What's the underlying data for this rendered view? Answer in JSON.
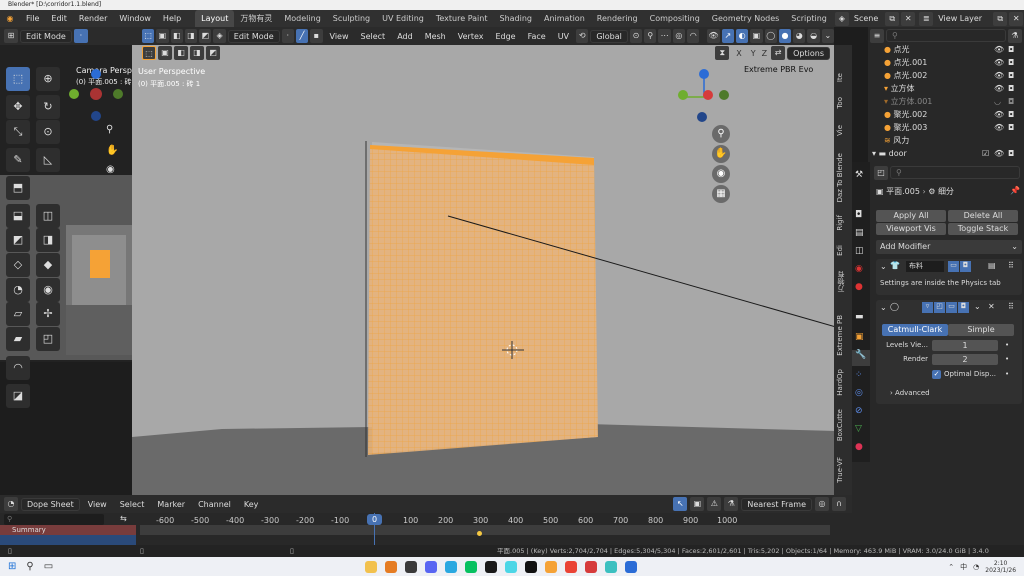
{
  "titlebar": {
    "title": "Blender* [D:\\corridor1.1.blend]"
  },
  "menu": [
    "File",
    "Edit",
    "Render",
    "Window",
    "Help"
  ],
  "workspaces": [
    "Layout",
    "万物有灵",
    "Modeling",
    "Sculpting",
    "UV Editing",
    "Texture Paint",
    "Shading",
    "Animation",
    "Rendering",
    "Compositing",
    "Geometry Nodes",
    "Scripting"
  ],
  "active_workspace": "Layout",
  "scene": "Scene",
  "view_layer": "View Layer",
  "cam_header": {
    "mode": "Edit Mode"
  },
  "view_header": {
    "mode": "Edit Mode",
    "menus": [
      "View",
      "Select",
      "Add",
      "Mesh",
      "Vertex",
      "Edge",
      "Face",
      "UV"
    ],
    "transform": "Global",
    "axes": [
      "X",
      "Y",
      "Z"
    ],
    "options": "Options"
  },
  "camera_overlay": {
    "title": "Camera Perspe",
    "sub": "(0) 平面.005 : 砖"
  },
  "viewport_overlay": {
    "title": "User Perspective",
    "sub": "(0) 平面.005 : 砖 1",
    "render_engine": "Extreme PBR Evo"
  },
  "side_tabs": [
    "Ite",
    "Too",
    "Vie",
    "Daz To Blende",
    "Rigif",
    "Edi",
    "万物有",
    "Extreme PB",
    "HardOp",
    "BoxCutte",
    "True-VF"
  ],
  "outliner": [
    {
      "name": "点光",
      "badge": "light"
    },
    {
      "name": "点光.001",
      "badge": "light"
    },
    {
      "name": "点光.002",
      "badge": "light"
    },
    {
      "name": "立方体",
      "badge": "mesh"
    },
    {
      "name": "立方体.001",
      "badge": "mesh"
    },
    {
      "name": "聚光.002",
      "badge": "light"
    },
    {
      "name": "聚光.003",
      "badge": "light"
    },
    {
      "name": "风力",
      "badge": "force"
    },
    {
      "name": "door",
      "badge": "collection"
    }
  ],
  "props": {
    "breadcrumb_obj": "平面.005",
    "breadcrumb_mod": "细分",
    "apply_all": "Apply All",
    "delete_all": "Delete All",
    "viewport_vis": "Viewport Vis",
    "toggle_stack": "Toggle Stack",
    "add_modifier": "Add Modifier",
    "cloth_name": "布料",
    "cloth_note": "Settings are inside the Physics tab",
    "subsurf_tabs": [
      "Catmull-Clark",
      "Simple"
    ],
    "levels_label": "Levels Vie...",
    "levels_value": "1",
    "render_label": "Render",
    "render_value": "2",
    "optimal_label": "Optimal Disp...",
    "advanced": "Advanced"
  },
  "timeline": {
    "editor": "Dope Sheet",
    "menus": [
      "View",
      "Select",
      "Marker",
      "Channel",
      "Key"
    ],
    "snap": "Nearest Frame",
    "summary": "Summary",
    "current_frame": "0",
    "frames": [
      "-600",
      "-500",
      "-400",
      "-300",
      "-200",
      "-100",
      "0",
      "100",
      "200",
      "300",
      "400",
      "500",
      "600",
      "700",
      "800",
      "900",
      "1000"
    ]
  },
  "status": "平面.005 | (Key) Verts:2,704/2,704 | Edges:5,304/5,304 | Faces:2,601/2,601 | Tris:5,202 | Objects:1/64 | Memory: 463.9 MiB | VRAM: 3.0/24.0 GiB | 3.4.0",
  "taskbar": {
    "time": "2:10",
    "date": "2023/1/26",
    "lang": "中"
  },
  "colors": {
    "accent": "#4772b3",
    "selection": "#f5a236",
    "viewport_bg": "#a8a8a8",
    "wall": "#c9c9c9"
  }
}
